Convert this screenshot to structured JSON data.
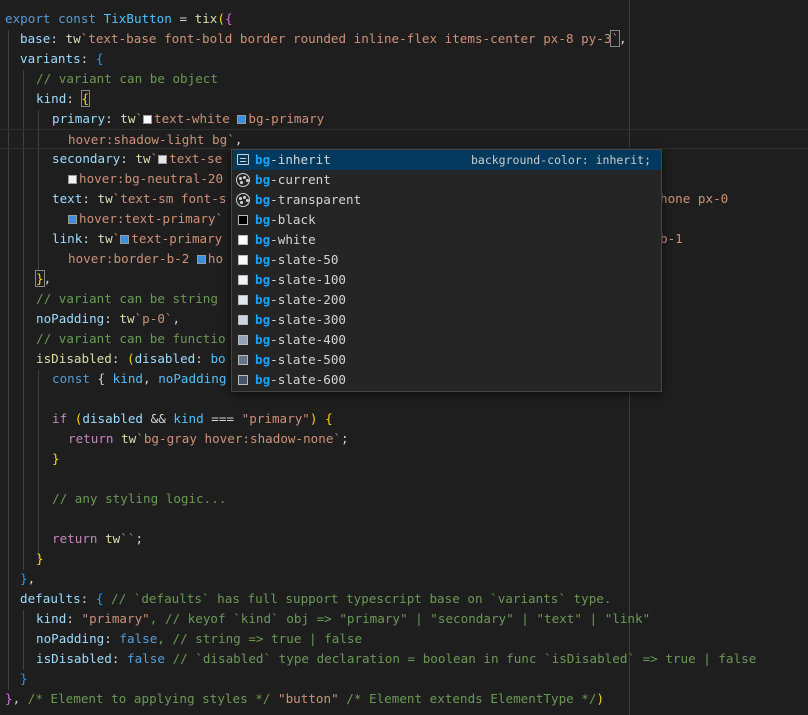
{
  "colors": {
    "background": "#1e1e1e",
    "keyword": "#569cd6",
    "control": "#c586c0",
    "variable": "#9cdcfe",
    "class": "#4fc1ff",
    "function": "#dcdcaa",
    "string": "#ce9178",
    "comment": "#6a9955",
    "suggest_highlight": "#18a3ff",
    "suggest_selected": "#04395e"
  },
  "code": {
    "l1": [
      "export",
      " ",
      "const",
      " ",
      "TixButton",
      " = ",
      "tix",
      "(",
      "{"
    ],
    "l2": [
      "base",
      ": ",
      "tw",
      "`text-base font-bold border rounded inline-flex items-center px-8 py-3",
      "`",
      ","
    ],
    "l3": [
      "variants",
      ": ",
      "{"
    ],
    "l4": "// variant can be object",
    "l5": [
      "kind",
      ": ",
      "{"
    ],
    "l6": [
      "primary",
      ": ",
      "tw",
      "`",
      "text-white ",
      "bg-primary"
    ],
    "l7": [
      "hover:shadow-light bg",
      "`",
      ","
    ],
    "l8": [
      "secondary",
      ": ",
      "tw",
      "`",
      "text-se"
    ],
    "l9": [
      "hover:bg-neutral-20"
    ],
    "l10": [
      "text",
      ": ",
      "tw",
      "`text-sm font-s",
      "hone px-0"
    ],
    "l11": [
      "hover:text-primary",
      "`"
    ],
    "l12": [
      "link",
      ": ",
      "tw",
      "`",
      "text-primary",
      "b-1"
    ],
    "l13": [
      "hover:border-b-2 ",
      "ho"
    ],
    "l14": [
      "}",
      ","
    ],
    "l15": "// variant can be string",
    "l16": [
      "noPadding",
      ": ",
      "tw",
      "`p-0`",
      ","
    ],
    "l17": "// variant can be functio",
    "l18": [
      "isDisabled",
      ": ",
      "(",
      "disabled",
      ": ",
      "bo"
    ],
    "l19": [
      "const",
      " { ",
      "kind",
      ", ",
      "noPadding"
    ],
    "l21": [
      "if",
      " ",
      "(",
      "disabled",
      " && ",
      "kind",
      " === ",
      "\"primary\"",
      ")",
      " {"
    ],
    "l22": [
      "return",
      " ",
      "tw",
      "`bg-gray hover:shadow-none`",
      ";"
    ],
    "l23": "}",
    "l25": "// any styling logic...",
    "l27": [
      "return",
      " ",
      "tw",
      "``",
      ";"
    ],
    "l28": "}",
    "l29": [
      "}",
      ","
    ],
    "l30": [
      "defaults",
      ": ",
      "{",
      " // `defaults` has full support typescript base on `variants` type."
    ],
    "l31": [
      "kind",
      ": ",
      "\"primary\"",
      ", // keyof `kind` obj => \"primary\" | \"secondary\" | \"text\" | \"link\""
    ],
    "l32": [
      "noPadding",
      ": ",
      "false",
      ", // string => true | false"
    ],
    "l33": [
      "isDisabled",
      ": ",
      "false",
      " // `disabled` type declaration = boolean in func `isDisabled` => true | false"
    ],
    "l34": "}",
    "l35": [
      "}",
      ", ",
      "/* Element to applying styles */",
      " ",
      "\"button\"",
      " ",
      "/* Element extends ElementType */",
      ")"
    ]
  },
  "suggest": {
    "items": [
      {
        "prefix": "bg",
        "rest": "-inherit",
        "icon": "text-icon",
        "detail": "background-color: inherit;",
        "swatch": ""
      },
      {
        "prefix": "bg",
        "rest": "-current",
        "icon": "palette-icon",
        "detail": "",
        "swatch": ""
      },
      {
        "prefix": "bg",
        "rest": "-transparent",
        "icon": "palette-icon",
        "detail": "",
        "swatch": ""
      },
      {
        "prefix": "bg",
        "rest": "-black",
        "icon": "color-swatch-icon",
        "detail": "",
        "swatch": "#000000"
      },
      {
        "prefix": "bg",
        "rest": "-white",
        "icon": "color-swatch-icon",
        "detail": "",
        "swatch": "#ffffff"
      },
      {
        "prefix": "bg",
        "rest": "-slate-50",
        "icon": "color-swatch-icon",
        "detail": "",
        "swatch": "#f8fafc"
      },
      {
        "prefix": "bg",
        "rest": "-slate-100",
        "icon": "color-swatch-icon",
        "detail": "",
        "swatch": "#f1f5f9"
      },
      {
        "prefix": "bg",
        "rest": "-slate-200",
        "icon": "color-swatch-icon",
        "detail": "",
        "swatch": "#e2e8f0"
      },
      {
        "prefix": "bg",
        "rest": "-slate-300",
        "icon": "color-swatch-icon",
        "detail": "",
        "swatch": "#cbd5e1"
      },
      {
        "prefix": "bg",
        "rest": "-slate-400",
        "icon": "color-swatch-icon",
        "detail": "",
        "swatch": "#94a3b8"
      },
      {
        "prefix": "bg",
        "rest": "-slate-500",
        "icon": "color-swatch-icon",
        "detail": "",
        "swatch": "#64748b"
      },
      {
        "prefix": "bg",
        "rest": "-slate-600",
        "icon": "color-swatch-icon",
        "detail": "",
        "swatch": "#475569"
      }
    ]
  }
}
